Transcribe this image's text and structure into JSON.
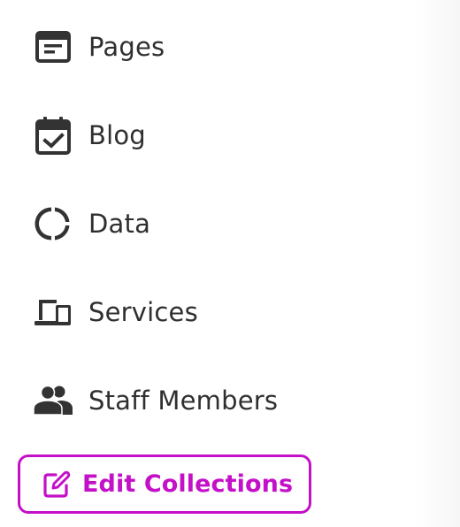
{
  "menu": {
    "items": [
      {
        "label": "Pages",
        "icon": "pages-icon"
      },
      {
        "label": "Blog",
        "icon": "calendar-check-icon"
      },
      {
        "label": "Data",
        "icon": "donut-chart-icon"
      },
      {
        "label": "Services",
        "icon": "devices-icon"
      },
      {
        "label": "Staff Members",
        "icon": "people-icon"
      }
    ]
  },
  "edit_collections": {
    "label": "Edit Collections",
    "icon": "edit-icon"
  },
  "colors": {
    "text": "#2f2f2f",
    "icon": "#333333",
    "accent": "#c410c8",
    "background": "#ffffff"
  }
}
